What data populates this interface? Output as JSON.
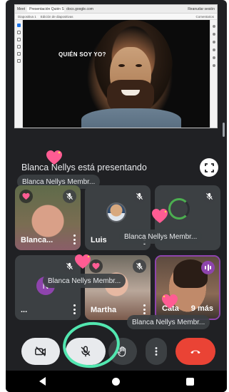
{
  "browser": {
    "tab_left": "Meet",
    "tab_active": "Presentación Quién Soy Yo",
    "address": "docs.google.com",
    "account": "Reanudar sesión"
  },
  "slides_app": {
    "menu_left": "Diapositiva 1",
    "menu_mid": "Edición de diapositivas",
    "menu_right": "Comentarios"
  },
  "slide": {
    "title": "QUIÉN SOY YO?"
  },
  "presenting_text": "Blanca Nellys está presentando",
  "tiles": [
    {
      "name": "Blanca...",
      "mic": "off"
    },
    {
      "name": "Luis",
      "mic": "off"
    },
    {
      "name": "",
      "mic": "off"
    },
    {
      "name": "...",
      "mic": "off"
    },
    {
      "name": "Martha",
      "mic": "off"
    },
    {
      "name": "Cata",
      "mic": "speaking",
      "extra": "9 más"
    }
  ],
  "chips": {
    "top": "Blanca Nellys Membr...",
    "mid_right": "Blanca Nellys Membr...",
    "mid_left": "Blanca Nellys Membr...",
    "bottom": "Blanca Nellys Membr..."
  },
  "avatar_initial": "N",
  "icons": {
    "camera": "camera-off-icon",
    "mic": "mic-off-icon",
    "hand": "raise-hand-icon",
    "more": "more-vert-icon",
    "leave": "call-end-icon",
    "fullscreen": "fullscreen-icon",
    "heart": "heart-reaction-icon"
  },
  "colors": {
    "background": "#202124",
    "tile": "#3c4043",
    "end_call": "#ea4335",
    "speaking": "#8e44ad",
    "highlight_ring": "#52e7b0",
    "heart": "#ff5c93"
  }
}
